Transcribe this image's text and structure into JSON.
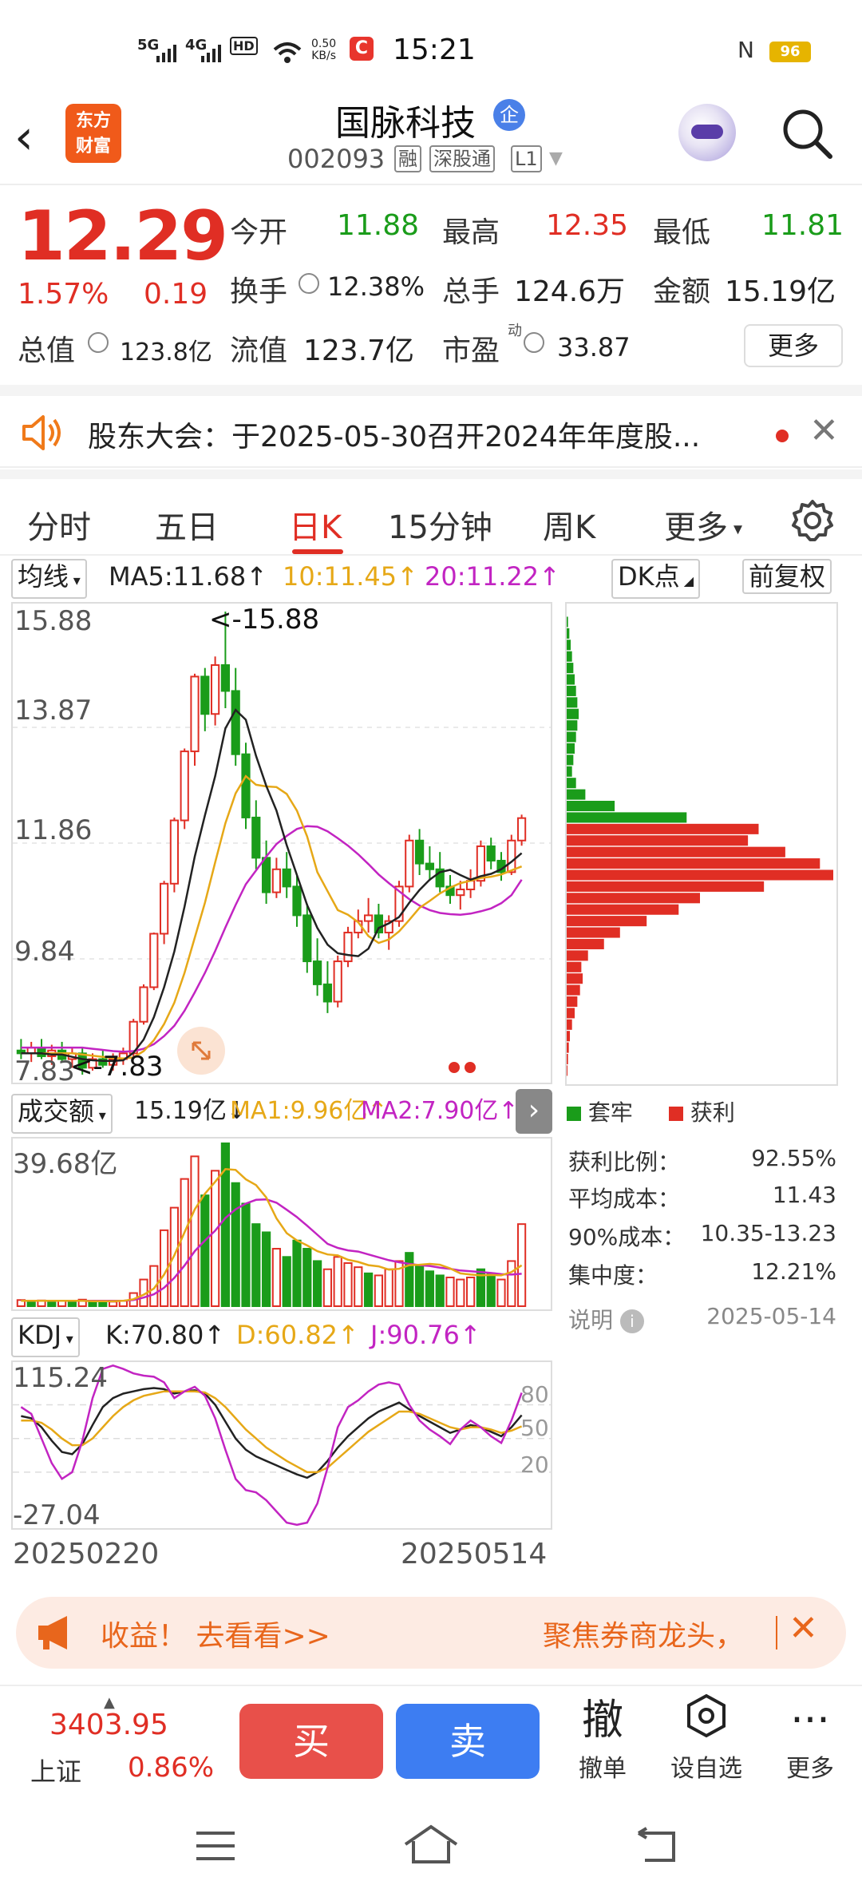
{
  "status_bar": {
    "signal_1": "5G",
    "signal_2": "4G",
    "hd": "HD",
    "net_speed": "0.50",
    "net_unit": "KB/s",
    "app_badge": "C",
    "time": "15:21",
    "battery": "96"
  },
  "header": {
    "logo_line1": "东方",
    "logo_line2": "财富",
    "stock_name": "国脉科技",
    "enterprise_badge": "企",
    "stock_code": "002093",
    "tags": [
      "融",
      "深股通",
      "L1"
    ]
  },
  "quote": {
    "price": "12.29",
    "change_pct": "1.57%",
    "change": "0.19",
    "open_label": "今开",
    "open": "11.88",
    "high_label": "最高",
    "high": "12.35",
    "low_label": "最低",
    "low": "11.81",
    "turnover_label": "换手",
    "turnover": "12.38%",
    "volume_label": "总手",
    "volume": "124.6万",
    "amount_label": "金额",
    "amount": "15.19亿",
    "mktcap_label": "总值",
    "mktcap": "123.8亿",
    "float_label": "流值",
    "float": "123.7亿",
    "pe_label": "市盈",
    "pe_sup": "动",
    "pe": "33.87",
    "more_button": "更多"
  },
  "notice": {
    "text": "股东大会：于2025-05-30召开2024年年度股..."
  },
  "tabs": {
    "items": [
      "分时",
      "五日",
      "日K",
      "15分钟",
      "周K",
      "更多"
    ],
    "active": "日K"
  },
  "ma_line": {
    "selector": "均线",
    "ma5": "MA5:11.68",
    "ma10": "10:11.45",
    "ma20": "20:11.22",
    "dk_button": "DK点",
    "fq_button": "前复权"
  },
  "kline": {
    "y_ticks": [
      "15.88",
      "13.87",
      "11.86",
      "9.84",
      "7.83"
    ],
    "high_marker": "<-15.88",
    "low_marker": "<-7.83"
  },
  "volume": {
    "selector": "成交额",
    "value": "15.19亿",
    "ma1": "MA1:9.96亿",
    "ma2": "MA2:7.90亿",
    "y_top": "39.68亿"
  },
  "kdj": {
    "selector": "KDJ",
    "k": "K:70.80",
    "d": "D:60.82",
    "j": "J:90.76",
    "y_top": "115.24",
    "y_bottom": "-27.04",
    "levels": [
      "80",
      "50",
      "20"
    ]
  },
  "dates": {
    "start": "20250220",
    "end": "20250514"
  },
  "chip_panel": {
    "legend_trapped": "套牢",
    "legend_profit": "获利",
    "rows": [
      {
        "label": "获利比例：",
        "value": "92.55%"
      },
      {
        "label": "平均成本：",
        "value": "11.43"
      },
      {
        "label": "90%成本：",
        "value": "10.35-13.23"
      },
      {
        "label": "集中度：",
        "value": "12.21%"
      }
    ],
    "note_label": "说明",
    "date": "2025-05-14"
  },
  "banner": {
    "left_text": "收益！ 去看看>>",
    "right_text": "聚焦券商龙头，"
  },
  "bottom_bar": {
    "index_value": "3403.95",
    "index_name": "上证",
    "index_pct": "0.86%",
    "buy": "买",
    "sell": "卖",
    "cancel_icon_char": "撤",
    "cancel_label": "撤单",
    "watch_label": "设自选",
    "more_label": "更多"
  },
  "colors": {
    "up_red": "#e02e24",
    "down_green": "#1a9c1a",
    "ma5_black": "#222222",
    "ma10_orange": "#e6a817",
    "ma20_purple": "#c224c2",
    "buy_button": "#e8504a",
    "sell_button": "#3d7df2"
  },
  "chart_data": [
    {
      "type": "candlestick",
      "title": "日K",
      "x_range": [
        "20250220",
        "20250514"
      ],
      "ylim": [
        7.83,
        15.88
      ],
      "candles": [
        {
          "o": 8.25,
          "h": 8.45,
          "l": 8.1,
          "c": 8.2
        },
        {
          "o": 8.2,
          "h": 8.4,
          "l": 8.05,
          "c": 8.3
        },
        {
          "o": 8.3,
          "h": 8.45,
          "l": 8.1,
          "c": 8.15
        },
        {
          "o": 8.15,
          "h": 8.35,
          "l": 8.0,
          "c": 8.25
        },
        {
          "o": 8.25,
          "h": 8.4,
          "l": 8.05,
          "c": 8.1
        },
        {
          "o": 8.1,
          "h": 8.3,
          "l": 7.95,
          "c": 8.2
        },
        {
          "o": 8.2,
          "h": 8.3,
          "l": 7.83,
          "c": 7.95
        },
        {
          "o": 7.95,
          "h": 8.2,
          "l": 7.9,
          "c": 8.1
        },
        {
          "o": 8.1,
          "h": 8.25,
          "l": 7.95,
          "c": 8.0
        },
        {
          "o": 8.0,
          "h": 8.2,
          "l": 7.9,
          "c": 8.1
        },
        {
          "o": 8.1,
          "h": 8.3,
          "l": 8.0,
          "c": 8.2
        },
        {
          "o": 8.2,
          "h": 8.8,
          "l": 8.15,
          "c": 8.75
        },
        {
          "o": 8.75,
          "h": 9.4,
          "l": 8.7,
          "c": 9.35
        },
        {
          "o": 9.35,
          "h": 10.3,
          "l": 9.3,
          "c": 10.28
        },
        {
          "o": 10.28,
          "h": 11.2,
          "l": 10.1,
          "c": 11.15
        },
        {
          "o": 11.15,
          "h": 12.3,
          "l": 11.0,
          "c": 12.25
        },
        {
          "o": 12.25,
          "h": 13.5,
          "l": 12.1,
          "c": 13.45
        },
        {
          "o": 13.45,
          "h": 14.8,
          "l": 13.2,
          "c": 14.75
        },
        {
          "o": 14.75,
          "h": 14.9,
          "l": 13.8,
          "c": 14.1
        },
        {
          "o": 14.1,
          "h": 15.1,
          "l": 13.9,
          "c": 14.95
        },
        {
          "o": 14.95,
          "h": 15.88,
          "l": 14.2,
          "c": 14.5
        },
        {
          "o": 14.5,
          "h": 14.9,
          "l": 13.2,
          "c": 13.4
        },
        {
          "o": 13.4,
          "h": 13.6,
          "l": 12.1,
          "c": 12.3
        },
        {
          "o": 12.3,
          "h": 12.6,
          "l": 11.4,
          "c": 11.6
        },
        {
          "o": 11.6,
          "h": 11.9,
          "l": 10.8,
          "c": 11.0
        },
        {
          "o": 11.0,
          "h": 11.6,
          "l": 10.9,
          "c": 11.4
        },
        {
          "o": 11.4,
          "h": 11.7,
          "l": 10.9,
          "c": 11.1
        },
        {
          "o": 11.1,
          "h": 11.3,
          "l": 10.4,
          "c": 10.6
        },
        {
          "o": 10.6,
          "h": 10.8,
          "l": 9.6,
          "c": 9.8
        },
        {
          "o": 9.8,
          "h": 10.2,
          "l": 9.2,
          "c": 9.4
        },
        {
          "o": 9.4,
          "h": 9.8,
          "l": 8.9,
          "c": 9.1
        },
        {
          "o": 9.1,
          "h": 9.9,
          "l": 9.0,
          "c": 9.8
        },
        {
          "o": 9.8,
          "h": 10.4,
          "l": 9.7,
          "c": 10.3
        },
        {
          "o": 10.3,
          "h": 10.7,
          "l": 10.2,
          "c": 10.5
        },
        {
          "o": 10.5,
          "h": 10.9,
          "l": 10.3,
          "c": 10.6
        },
        {
          "o": 10.6,
          "h": 10.8,
          "l": 10.2,
          "c": 10.3
        },
        {
          "o": 10.3,
          "h": 10.6,
          "l": 10.0,
          "c": 10.5
        },
        {
          "o": 10.5,
          "h": 11.2,
          "l": 10.4,
          "c": 11.1
        },
        {
          "o": 11.1,
          "h": 12.0,
          "l": 11.0,
          "c": 11.9
        },
        {
          "o": 11.9,
          "h": 12.1,
          "l": 11.3,
          "c": 11.5
        },
        {
          "o": 11.5,
          "h": 11.8,
          "l": 11.2,
          "c": 11.4
        },
        {
          "o": 11.4,
          "h": 11.7,
          "l": 11.0,
          "c": 11.1
        },
        {
          "o": 11.1,
          "h": 11.3,
          "l": 10.8,
          "c": 10.95
        },
        {
          "o": 10.95,
          "h": 11.2,
          "l": 10.7,
          "c": 11.05
        },
        {
          "o": 11.05,
          "h": 11.4,
          "l": 10.9,
          "c": 11.2
        },
        {
          "o": 11.2,
          "h": 11.9,
          "l": 11.1,
          "c": 11.8
        },
        {
          "o": 11.8,
          "h": 11.95,
          "l": 11.4,
          "c": 11.55
        },
        {
          "o": 11.55,
          "h": 11.7,
          "l": 11.2,
          "c": 11.35
        },
        {
          "o": 11.35,
          "h": 12.0,
          "l": 11.3,
          "c": 11.9
        },
        {
          "o": 11.9,
          "h": 12.35,
          "l": 11.81,
          "c": 12.29
        }
      ],
      "ma5": [
        8.2,
        8.2,
        8.2,
        8.18,
        8.18,
        8.14,
        8.1,
        8.08,
        8.07,
        8.07,
        8.08,
        8.21,
        8.44,
        8.83,
        9.35,
        9.97,
        10.75,
        11.62,
        12.34,
        13.02,
        13.85,
        14.17,
        14.0,
        13.37,
        12.85,
        12.42,
        11.82,
        11.3,
        10.78,
        10.38,
        10.09,
        9.94,
        9.91,
        9.89,
        10.02,
        10.38,
        10.46,
        10.57,
        10.82,
        11.04,
        11.22,
        11.35,
        11.39,
        11.3,
        11.22,
        11.28,
        11.32,
        11.4,
        11.53,
        11.68
      ],
      "ma10": [
        8.2,
        8.2,
        8.2,
        8.2,
        8.2,
        8.2,
        8.18,
        8.16,
        8.14,
        8.12,
        8.11,
        8.13,
        8.24,
        8.43,
        8.71,
        9.08,
        9.6,
        10.21,
        10.82,
        11.52,
        12.2,
        12.72,
        13.02,
        12.87,
        12.84,
        12.83,
        12.71,
        12.42,
        11.97,
        11.35,
        11.02,
        10.69,
        10.61,
        10.48,
        10.24,
        10.12,
        10.18,
        10.32,
        10.52,
        10.73,
        10.85,
        10.98,
        11.08,
        11.16,
        11.2,
        11.25,
        11.27,
        11.31,
        11.38,
        11.45
      ],
      "ma20": [
        8.3,
        8.3,
        8.3,
        8.3,
        8.3,
        8.3,
        8.3,
        8.28,
        8.26,
        8.24,
        8.23,
        8.24,
        8.28,
        8.36,
        8.5,
        8.68,
        8.94,
        9.26,
        9.6,
        9.98,
        10.39,
        10.78,
        11.14,
        11.38,
        11.62,
        11.84,
        11.98,
        12.1,
        12.15,
        12.14,
        12.06,
        11.94,
        11.81,
        11.66,
        11.49,
        11.31,
        11.16,
        11.02,
        10.88,
        10.77,
        10.69,
        10.64,
        10.62,
        10.61,
        10.63,
        10.67,
        10.72,
        10.81,
        10.95,
        11.22
      ]
    },
    {
      "type": "bar",
      "title": "成交额",
      "ylim": [
        0,
        39.68
      ],
      "unit": "亿",
      "values": [
        1.5,
        1.2,
        1.4,
        1.0,
        1.3,
        1.1,
        1.6,
        1.2,
        1.0,
        1.1,
        1.3,
        3.2,
        6.5,
        9.8,
        18.5,
        24.0,
        31.0,
        36.5,
        27.0,
        33.0,
        39.68,
        30.0,
        25.0,
        20.0,
        18.0,
        14.0,
        12.0,
        16.0,
        14.0,
        11.0,
        9.0,
        12.0,
        10.5,
        9.5,
        8.0,
        7.5,
        9.0,
        11.0,
        13.0,
        10.0,
        8.5,
        7.5,
        7.0,
        6.5,
        7.0,
        9.0,
        8.0,
        6.5,
        11.0,
        20.0
      ],
      "ma1": [
        1.3,
        1.3,
        1.3,
        1.3,
        1.3,
        1.3,
        1.3,
        1.2,
        1.2,
        1.2,
        1.3,
        1.7,
        2.8,
        4.3,
        7.7,
        12.4,
        18.0,
        23.6,
        27.4,
        30.3,
        33.4,
        33.2,
        30.9,
        29.5,
        26.5,
        21.4,
        17.8,
        16.0,
        14.8,
        13.4,
        12.6,
        12.4,
        11.3,
        10.8,
        10.0,
        9.7,
        8.9,
        9.1,
        10.0,
        10.1,
        10.3,
        10.1,
        9.2,
        8.0,
        7.7,
        7.5,
        7.6,
        7.5,
        8.3,
        9.96
      ],
      "ma2": [
        1.3,
        1.3,
        1.3,
        1.3,
        1.3,
        1.3,
        1.3,
        1.3,
        1.3,
        1.3,
        1.3,
        1.5,
        2.1,
        2.9,
        4.5,
        6.9,
        9.9,
        13.4,
        16.0,
        18.4,
        21.5,
        23.6,
        25.0,
        25.9,
        26.0,
        25.2,
        23.5,
        21.7,
        19.6,
        17.4,
        15.2,
        14.2,
        13.6,
        13.3,
        12.6,
        11.9,
        11.2,
        10.7,
        10.3,
        10.0,
        9.8,
        9.4,
        9.1,
        8.7,
        8.5,
        8.3,
        8.1,
        7.8,
        7.7,
        7.9
      ],
      "up": [
        true,
        false,
        true,
        false,
        true,
        false,
        true,
        false,
        false,
        true,
        true,
        true,
        true,
        true,
        true,
        true,
        true,
        true,
        false,
        true,
        false,
        false,
        false,
        false,
        false,
        true,
        false,
        false,
        false,
        false,
        true,
        true,
        true,
        true,
        false,
        true,
        true,
        true,
        false,
        false,
        false,
        false,
        true,
        true,
        true,
        false,
        false,
        true,
        true,
        true
      ]
    },
    {
      "type": "line",
      "title": "KDJ",
      "ylim": [
        -27.04,
        115.24
      ],
      "series": [
        {
          "name": "K",
          "values": [
            70,
            68,
            60,
            48,
            38,
            36,
            45,
            62,
            78,
            86,
            90,
            92,
            94,
            95,
            94,
            90,
            92,
            93,
            90,
            80,
            65,
            50,
            40,
            34,
            30,
            26,
            22,
            18,
            15,
            20,
            30,
            42,
            52,
            60,
            68,
            74,
            78,
            82,
            76,
            70,
            65,
            60,
            55,
            58,
            62,
            60,
            56,
            52,
            60,
            70.8
          ]
        },
        {
          "name": "D",
          "values": [
            66,
            66,
            64,
            58,
            50,
            44,
            44,
            50,
            60,
            70,
            78,
            84,
            88,
            90,
            92,
            92,
            92,
            92,
            91,
            86,
            78,
            68,
            58,
            50,
            42,
            36,
            30,
            25,
            20,
            20,
            24,
            32,
            40,
            48,
            56,
            62,
            68,
            74,
            74,
            72,
            68,
            64,
            60,
            58,
            60,
            60,
            58,
            55,
            57,
            60.82
          ]
        },
        {
          "name": "J",
          "values": [
            78,
            72,
            50,
            28,
            14,
            20,
            48,
            86,
            112,
            115,
            112,
            108,
            106,
            105,
            100,
            86,
            92,
            96,
            88,
            68,
            40,
            14,
            4,
            2,
            -5,
            -15,
            -25,
            -27,
            -25,
            -8,
            24,
            60,
            78,
            84,
            92,
            98,
            100,
            98,
            80,
            66,
            58,
            52,
            45,
            58,
            66,
            60,
            52,
            46,
            66,
            90.76
          ]
        }
      ]
    },
    {
      "type": "bar",
      "title": "筹码分布",
      "orientation": "horizontal",
      "ylim": [
        7.83,
        15.88
      ],
      "price_levels": [
        15.7,
        15.5,
        15.3,
        15.1,
        14.9,
        14.7,
        14.5,
        14.3,
        14.1,
        13.9,
        13.7,
        13.5,
        13.3,
        13.1,
        12.9,
        12.7,
        12.5,
        12.3,
        12.1,
        11.9,
        11.7,
        11.5,
        11.3,
        11.1,
        10.9,
        10.7,
        10.5,
        10.3,
        10.1,
        9.9,
        9.7,
        9.5,
        9.3,
        9.1,
        8.9,
        8.7,
        8.5,
        8.3,
        8.1,
        7.9
      ],
      "values": [
        0.005,
        0.01,
        0.015,
        0.02,
        0.025,
        0.03,
        0.035,
        0.04,
        0.045,
        0.04,
        0.035,
        0.03,
        0.025,
        0.02,
        0.035,
        0.07,
        0.18,
        0.45,
        0.72,
        0.68,
        0.82,
        0.95,
        1.0,
        0.74,
        0.5,
        0.42,
        0.3,
        0.2,
        0.14,
        0.08,
        0.055,
        0.06,
        0.05,
        0.04,
        0.03,
        0.02,
        0.012,
        0.008,
        0.005,
        0.003
      ],
      "trapped_above": 12.29
    }
  ]
}
